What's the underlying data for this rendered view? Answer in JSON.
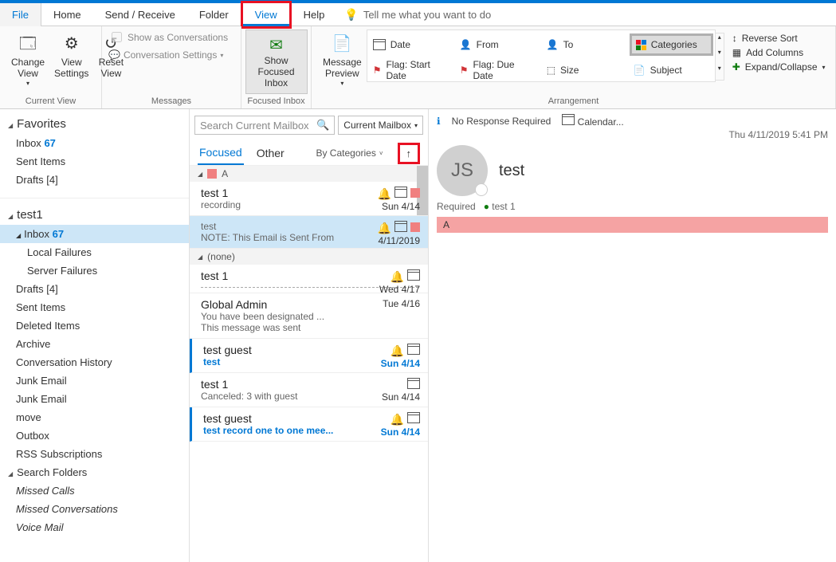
{
  "menu": {
    "file": "File",
    "home": "Home",
    "sendreceive": "Send / Receive",
    "folder": "Folder",
    "view": "View",
    "help": "Help",
    "tellme": "Tell me what you want to do"
  },
  "ribbon": {
    "currentview": {
      "label": "Current View",
      "change": "Change\nView",
      "settings": "View\nSettings",
      "reset": "Reset\nView"
    },
    "messages": {
      "label": "Messages",
      "showconv": "Show as Conversations",
      "convset": "Conversation Settings"
    },
    "focused": {
      "label": "Focused Inbox",
      "show": "Show\nFocused Inbox"
    },
    "preview": {
      "btn": "Message\nPreview"
    },
    "arrangement": {
      "label": "Arrangement",
      "date": "Date",
      "from": "From",
      "to": "To",
      "categories": "Categories",
      "flagstart": "Flag: Start Date",
      "flagdue": "Flag: Due Date",
      "size": "Size",
      "subject": "Subject",
      "reverse": "Reverse Sort",
      "addcols": "Add Columns",
      "expand": "Expand/Collapse"
    }
  },
  "nav": {
    "favorites": "Favorites",
    "fav_items": [
      {
        "t": "Inbox",
        "c": "67"
      },
      {
        "t": "Sent Items"
      },
      {
        "t": "Drafts",
        "suffix": "[4]"
      }
    ],
    "acct": "test1",
    "acct_items": [
      {
        "t": "Inbox",
        "c": "67",
        "sel": true
      },
      {
        "t": "Local Failures",
        "sub": true
      },
      {
        "t": "Server Failures",
        "sub": true
      },
      {
        "t": "Drafts",
        "suffix": "[4]"
      },
      {
        "t": "Sent Items"
      },
      {
        "t": "Deleted Items"
      },
      {
        "t": "Archive"
      },
      {
        "t": "Conversation History"
      },
      {
        "t": "Junk Email"
      },
      {
        "t": "Junk Email"
      },
      {
        "t": "move"
      },
      {
        "t": "Outbox"
      },
      {
        "t": "RSS Subscriptions"
      }
    ],
    "search": "Search Folders",
    "search_items": [
      {
        "t": "Missed Calls",
        "i": true
      },
      {
        "t": "Missed Conversations",
        "i": true
      },
      {
        "t": "Voice Mail",
        "i": true
      }
    ]
  },
  "list": {
    "search_ph": "Search Current Mailbox",
    "scope": "Current Mailbox",
    "tabs": {
      "focused": "Focused",
      "other": "Other"
    },
    "sortby": "By Categories",
    "catA": "A",
    "catNone": "(none)",
    "msgs_a": [
      {
        "from": "test 1",
        "prev": "recording",
        "date": "Sun 4/14",
        "bell": true,
        "cal": true,
        "swatch": true
      },
      {
        "from": "",
        "prev": "test",
        "note": "NOTE: This Email is Sent From",
        "date": "4/11/2019",
        "bell": true,
        "cal": true,
        "swatch": true,
        "sel": true
      }
    ],
    "msgs_none": [
      {
        "from": "test 1",
        "prev": "",
        "date": "Wed 4/17",
        "bell": true,
        "cal": true,
        "dotted": true
      },
      {
        "from": "Global Admin",
        "prev": "You have been designated ...",
        "note": "This message was sent",
        "date": "Tue 4/16"
      },
      {
        "from": "test guest",
        "prev": "test",
        "date": "Sun 4/14",
        "bell": true,
        "cal": true,
        "unread": true
      },
      {
        "from": "test 1",
        "prev": "Canceled: 3 with guest",
        "date": "Sun 4/14",
        "calx": true
      },
      {
        "from": "test guest",
        "prev": "test record one to one mee...",
        "date": "Sun 4/14",
        "bell": true,
        "cal": true,
        "unread": true
      }
    ]
  },
  "reading": {
    "noresp": "No Response Required",
    "calendar": "Calendar...",
    "date": "Thu 4/11/2019 5:41 PM",
    "initials": "JS",
    "subject": "test",
    "required": "Required",
    "attendee": "test 1",
    "catA": "A"
  }
}
